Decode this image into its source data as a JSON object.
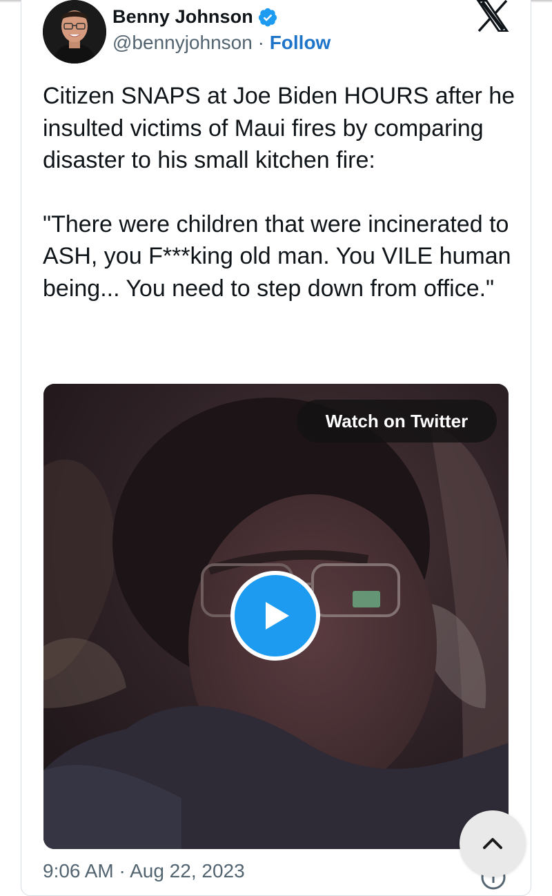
{
  "author": {
    "name": "Benny Johnson",
    "handle": "@bennyjohnson",
    "separator": " · ",
    "follow_label": "Follow"
  },
  "icons": {
    "verified": "verified-badge-icon",
    "platform": "x-logo-icon",
    "play": "play-icon",
    "scroll": "chevron-up-icon",
    "info": "info-icon"
  },
  "tweet": {
    "paragraph_1": "Citizen SNAPS at Joe Biden HOURS after he insulted victims of Maui fires by comparing disaster to his small kitchen fire:",
    "paragraph_2": "\"There were children that were incinerated to ASH, you F***king old man. You VILE human being... You need to step down from office.\""
  },
  "media": {
    "watch_label": "Watch on Twitter"
  },
  "timestamp": "9:06 AM · Aug 22, 2023",
  "colors": {
    "accent": "#1d9bf0",
    "follow": "#1d74c9",
    "secondary_text": "#536471"
  }
}
